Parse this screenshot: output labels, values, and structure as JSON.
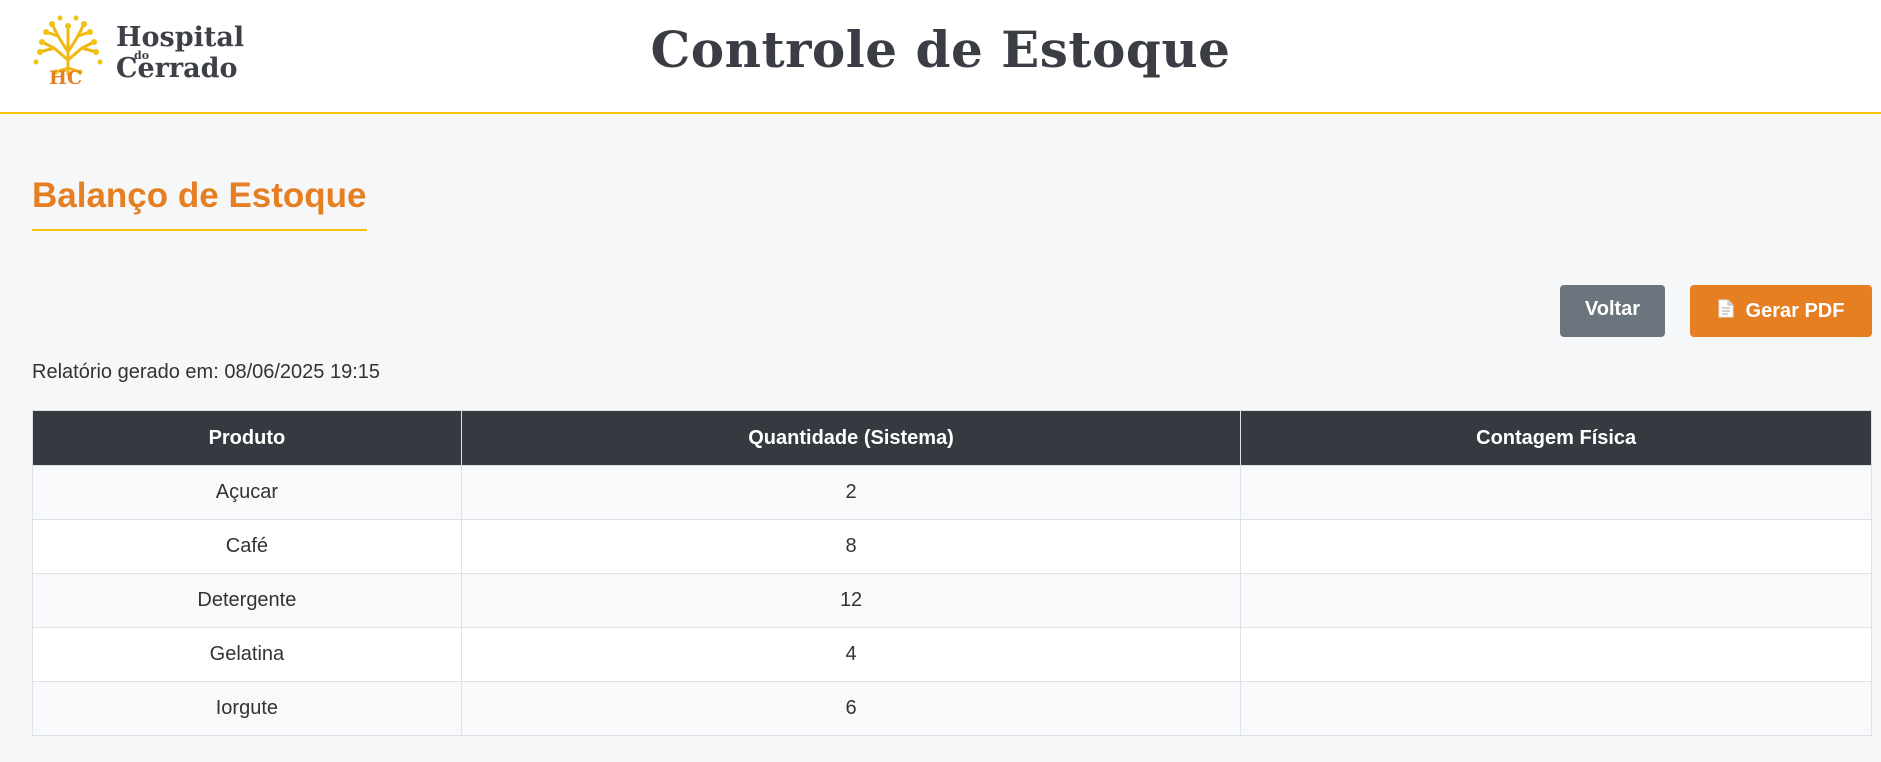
{
  "header": {
    "logo": {
      "mark": "HC",
      "line1": "Hospital",
      "line2": "do",
      "line3": "Cerrado"
    },
    "title": "Controle de Estoque"
  },
  "section": {
    "title": "Balanço de Estoque"
  },
  "actions": {
    "back_label": "Voltar",
    "pdf_label": "Gerar PDF",
    "pdf_icon": "document-icon"
  },
  "report": {
    "date_text": "Relatório gerado em: 08/06/2025 19:15"
  },
  "table": {
    "headers": [
      "Produto",
      "Quantidade (Sistema)",
      "Contagem Física"
    ],
    "rows": [
      {
        "produto": "Açucar",
        "quantidade": "2",
        "contagem": ""
      },
      {
        "produto": "Café",
        "quantidade": "8",
        "contagem": ""
      },
      {
        "produto": "Detergente",
        "quantidade": "12",
        "contagem": ""
      },
      {
        "produto": "Gelatina",
        "quantidade": "4",
        "contagem": ""
      },
      {
        "produto": "Iorgute",
        "quantidade": "6",
        "contagem": ""
      }
    ]
  },
  "colors": {
    "accent": "#e67e22",
    "gold": "#f1c40f",
    "header_dark": "#343a40",
    "button_gray": "#6c757d"
  }
}
